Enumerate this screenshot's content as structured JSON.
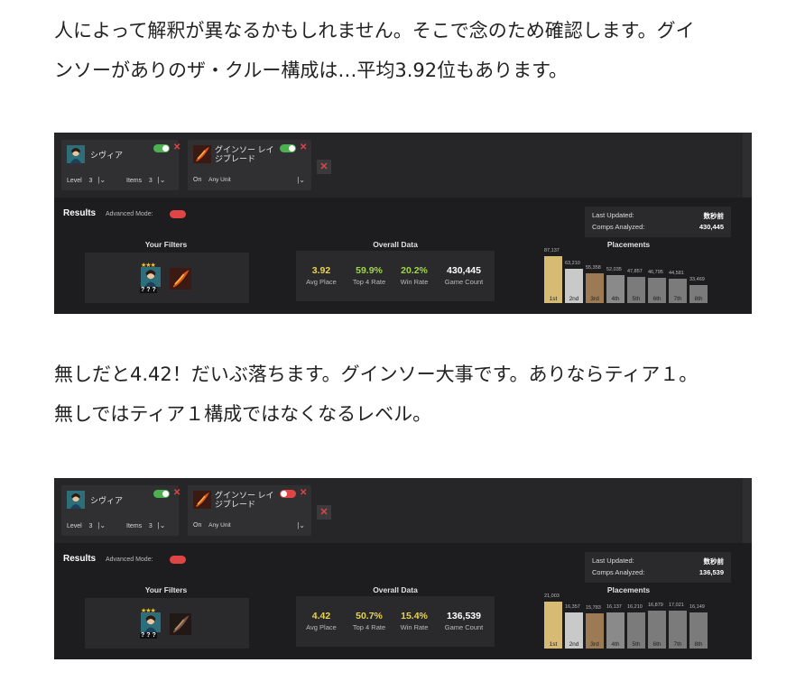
{
  "paragraph1": {
    "line1": "人によって解釈が異なるかもしれません。そこで念のため確認します。グイ",
    "line2": "ンソーがありのザ・クルー構成は…平均3.92位もあります。"
  },
  "paragraph2": {
    "line1": "無しだと4.42！だいぶ落ちます。グインソー大事です。ありならティア１。",
    "line2": "無しではティア１構成ではなくなるレベル。"
  },
  "panels": [
    {
      "unit1_name": "シヴィア",
      "item_name_line1": "グインソー レイ",
      "item_name_line2": "ジブレード",
      "item_toggle_on": true,
      "level_label": "Level",
      "level_value": "3",
      "items_label": "Items",
      "items_value": "3",
      "on_label": "On",
      "any_unit": "Any Unit",
      "results": "Results",
      "advanced_mode": "Advanced Mode:",
      "last_updated_label": "Last Updated:",
      "last_updated_value": "数秒前",
      "comps_label": "Comps Analyzed:",
      "comps_value": "430,445",
      "your_filters": "Your Filters",
      "overall_data": "Overall Data",
      "placements_title": "Placements",
      "qqq": "? ? ?",
      "stats": [
        {
          "value": "3.92",
          "label": "Avg Place",
          "color": "#e8d44d"
        },
        {
          "value": "59.9%",
          "label": "Top 4 Rate",
          "color": "#9fd845"
        },
        {
          "value": "20.2%",
          "label": "Win Rate",
          "color": "#9fd845"
        },
        {
          "value": "430,445",
          "label": "Game Count",
          "color": "#ffffff"
        }
      ],
      "placements": [
        {
          "label": "1st",
          "count": "87,137",
          "value": 87137,
          "color": "#d8bb72"
        },
        {
          "label": "2nd",
          "count": "63,210",
          "value": 63210,
          "color": "#c9c9c9"
        },
        {
          "label": "3rd",
          "count": "55,358",
          "value": 55358,
          "color": "#9b7a54"
        },
        {
          "label": "4th",
          "count": "52,035",
          "value": 52035,
          "color": "#8a8a8a"
        },
        {
          "label": "5th",
          "count": "47,857",
          "value": 47857,
          "color": "#7b7b7b"
        },
        {
          "label": "6th",
          "count": "46,795",
          "value": 46795,
          "color": "#7b7b7b"
        },
        {
          "label": "7th",
          "count": "44,581",
          "value": 44581,
          "color": "#7b7b7b"
        },
        {
          "label": "8th",
          "count": "33,469",
          "value": 33469,
          "color": "#7b7b7b"
        }
      ]
    },
    {
      "unit1_name": "シヴィア",
      "item_name_line1": "グインソー レイ",
      "item_name_line2": "ジブレード",
      "item_toggle_on": false,
      "level_label": "Level",
      "level_value": "3",
      "items_label": "Items",
      "items_value": "3",
      "on_label": "On",
      "any_unit": "Any Unit",
      "results": "Results",
      "advanced_mode": "Advanced Mode:",
      "last_updated_label": "Last Updated:",
      "last_updated_value": "数秒前",
      "comps_label": "Comps Analyzed:",
      "comps_value": "136,539",
      "your_filters": "Your Filters",
      "overall_data": "Overall Data",
      "placements_title": "Placements",
      "qqq": "? ? ?",
      "stats": [
        {
          "value": "4.42",
          "label": "Avg Place",
          "color": "#e8d44d"
        },
        {
          "value": "50.7%",
          "label": "Top 4 Rate",
          "color": "#e8d44d"
        },
        {
          "value": "15.4%",
          "label": "Win Rate",
          "color": "#e8d44d"
        },
        {
          "value": "136,539",
          "label": "Game Count",
          "color": "#ffffff"
        }
      ],
      "placements": [
        {
          "label": "1st",
          "count": "21,003",
          "value": 21003,
          "color": "#d8bb72"
        },
        {
          "label": "2nd",
          "count": "16,357",
          "value": 16357,
          "color": "#c9c9c9"
        },
        {
          "label": "3rd",
          "count": "15,783",
          "value": 15783,
          "color": "#9b7a54"
        },
        {
          "label": "4th",
          "count": "16,137",
          "value": 16137,
          "color": "#8a8a8a"
        },
        {
          "label": "5th",
          "count": "16,210",
          "value": 16210,
          "color": "#7b7b7b"
        },
        {
          "label": "6th",
          "count": "16,879",
          "value": 16879,
          "color": "#7b7b7b"
        },
        {
          "label": "7th",
          "count": "17,021",
          "value": 17021,
          "color": "#7b7b7b"
        },
        {
          "label": "8th",
          "count": "16,149",
          "value": 16149,
          "color": "#7b7b7b"
        }
      ]
    }
  ]
}
